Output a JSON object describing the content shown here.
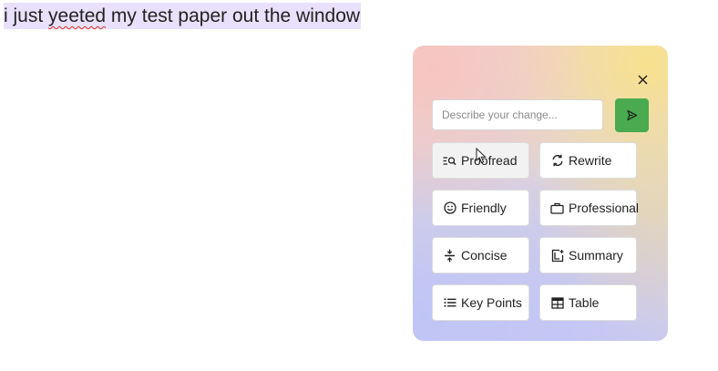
{
  "document": {
    "line_before": "i just ",
    "misspelled_word": "yeeted",
    "line_after": " my test paper out the window"
  },
  "rewrite_panel": {
    "close_icon": "close-icon",
    "prompt": {
      "placeholder": "Describe your change...",
      "value": ""
    },
    "send_icon": "send-icon",
    "send_color": "#4aaa4f",
    "actions": [
      {
        "label": "Proofread",
        "icon": "proofread-icon"
      },
      {
        "label": "Rewrite",
        "icon": "rewrite-icon"
      },
      {
        "label": "Friendly",
        "icon": "smiley-icon"
      },
      {
        "label": "Professional",
        "icon": "briefcase-icon"
      },
      {
        "label": "Concise",
        "icon": "concise-icon"
      },
      {
        "label": "Summary",
        "icon": "summary-icon"
      },
      {
        "label": "Key Points",
        "icon": "list-icon"
      },
      {
        "label": "Table",
        "icon": "table-icon"
      }
    ]
  }
}
